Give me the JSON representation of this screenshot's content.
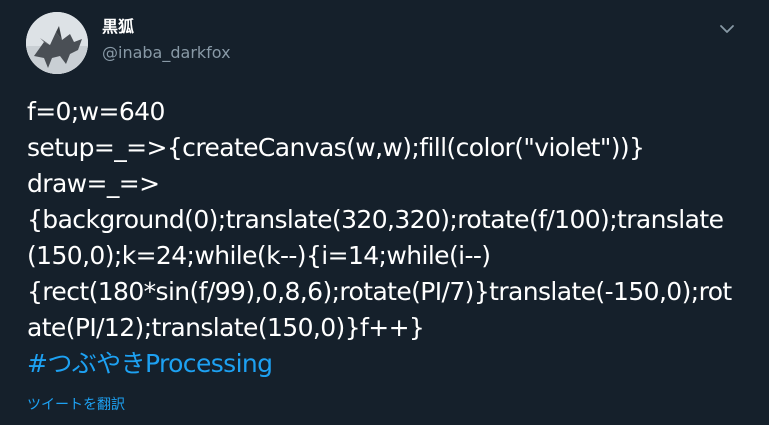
{
  "user": {
    "display_name": "黒狐",
    "handle": "@inaba_darkfox",
    "avatar_icon": "avatar-photo"
  },
  "menu": {
    "icon": "chevron-down-icon"
  },
  "tweet": {
    "lines": [
      "f=0;w=640",
      "setup=_=>{createCanvas(w,w);fill(color(\"violet\"))}",
      "draw=_=>",
      "{background(0);translate(320,320);rotate(f/100);translate",
      "(150,0);k=24;while(k--){i=14;while(i--)",
      "{rect(180*sin(f/99),0,8,6);rotate(PI/7)}translate(-150,0);rot",
      "ate(PI/12);translate(150,0)}f++}"
    ],
    "hashtag": "#つぶやきProcessing",
    "translate_label": "ツイートを翻訳"
  },
  "colors": {
    "background": "#15202b",
    "text": "#ffffff",
    "secondary": "#8899a6",
    "accent": "#1da1f2"
  }
}
